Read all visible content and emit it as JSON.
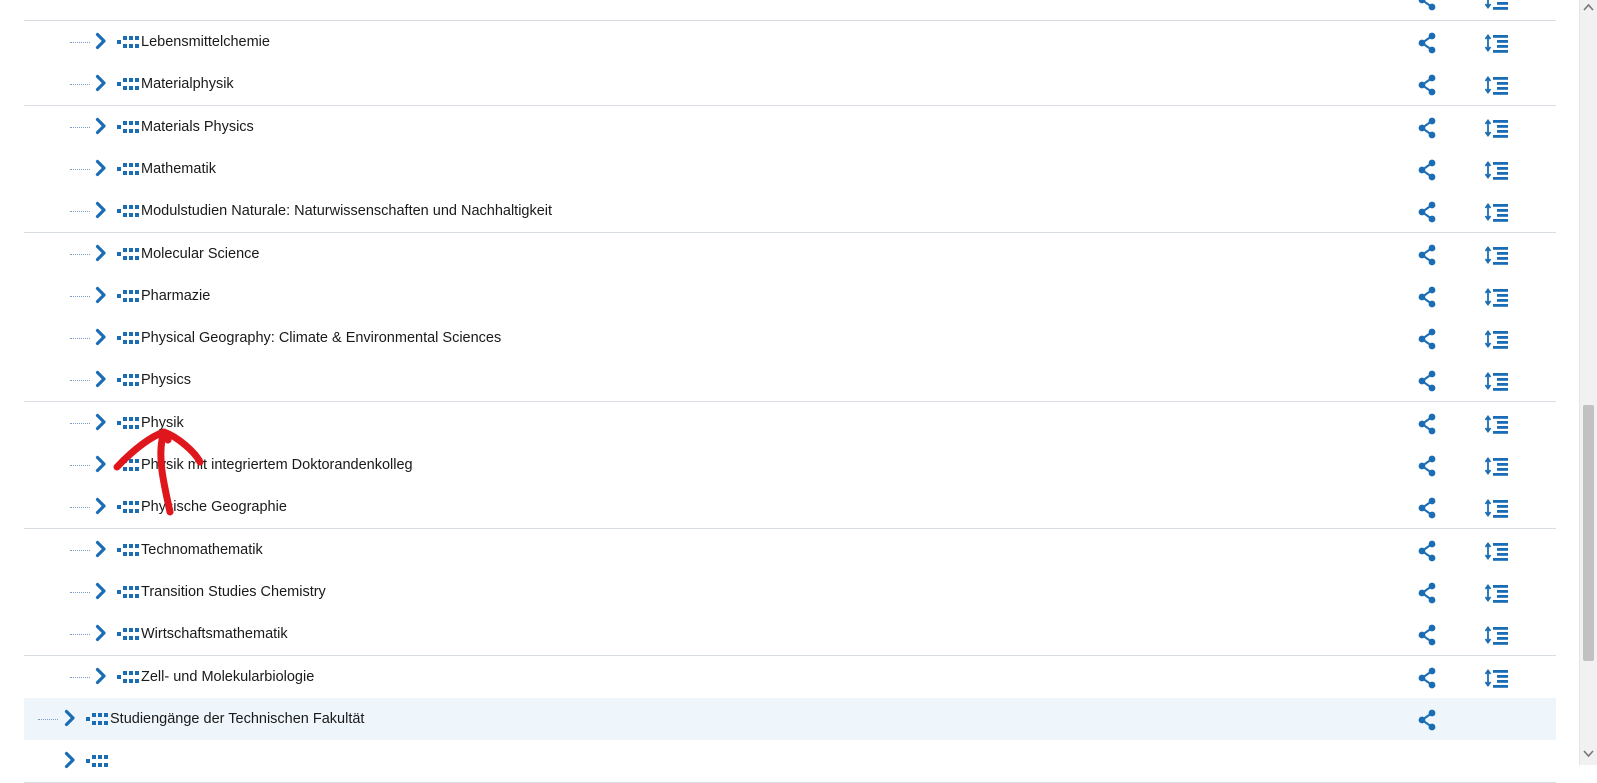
{
  "tree": {
    "children": [
      {
        "label": "Lebensmittelchemie"
      },
      {
        "label": "Materialphysik"
      },
      {
        "label": "Materials Physics"
      },
      {
        "label": "Mathematik"
      },
      {
        "label": "Modulstudien Naturale: Naturwissenschaften und Nachhaltigkeit"
      },
      {
        "label": "Molecular Science"
      },
      {
        "label": "Pharmazie"
      },
      {
        "label": "Physical Geography: Climate & Environmental Sciences"
      },
      {
        "label": "Physics"
      },
      {
        "label": "Physik"
      },
      {
        "label": "Physik mit integriertem Doktorandenkolleg"
      },
      {
        "label": "Physische Geographie"
      },
      {
        "label": "Technomathematik"
      },
      {
        "label": "Transition Studies Chemistry"
      },
      {
        "label": "Wirtschaftsmathematik"
      },
      {
        "label": "Zell- und Molekularbiologie"
      }
    ],
    "parent": {
      "label": "Studiengänge der Technischen Fakultät"
    }
  },
  "colors": {
    "accent": "#1a6db5",
    "parent_row_bg": "#eef6fc",
    "annotation": "#e0161d"
  },
  "icons": {
    "expand": "chevron-right-icon",
    "node": "module-tree-icon",
    "share": "share-icon",
    "details": "detail-list-icon"
  }
}
